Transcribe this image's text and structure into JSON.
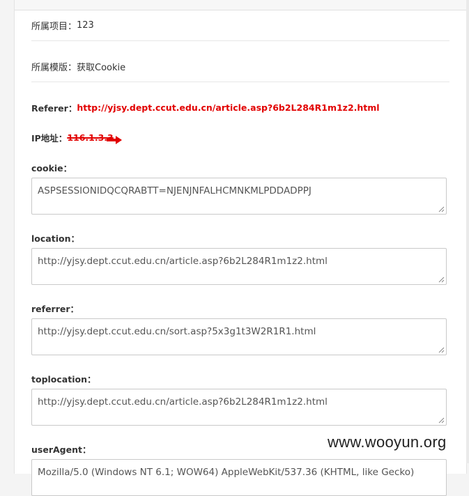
{
  "project": {
    "label": "所属项目：",
    "value": "123"
  },
  "template": {
    "label": "所属模版：",
    "value": "获取Cookie"
  },
  "referer": {
    "label": "Referer：",
    "value": "http://yjsy.dept.ccut.edu.cn/article.asp?6b2L284R1m1z2.html"
  },
  "ip": {
    "label": "IP地址：",
    "value": "116.1.3.3"
  },
  "fields": [
    {
      "label": "cookie：",
      "value": "ASPSESSIONIDQCQRABTT=NJENJNFALHCMNKMLPDDADPPJ"
    },
    {
      "label": "location：",
      "value": "http://yjsy.dept.ccut.edu.cn/article.asp?6b2L284R1m1z2.html"
    },
    {
      "label": "referrer：",
      "value": "http://yjsy.dept.ccut.edu.cn/sort.asp?5x3g1t3W2R1R1.html"
    },
    {
      "label": "toplocation：",
      "value": "http://yjsy.dept.ccut.edu.cn/article.asp?6b2L284R1m1z2.html"
    },
    {
      "label": "userAgent：",
      "value": "Mozilla/5.0 (Windows NT 6.1; WOW64) AppleWebKit/537.36 (KHTML, like Gecko)"
    }
  ],
  "watermark": "www.wooyun.org",
  "colors": {
    "red": "#e20000",
    "border": "#c9c9c9"
  },
  "icons": {
    "redaction_arrow": "arrow-right-icon",
    "resize_grip": "resize-grip-icon"
  }
}
